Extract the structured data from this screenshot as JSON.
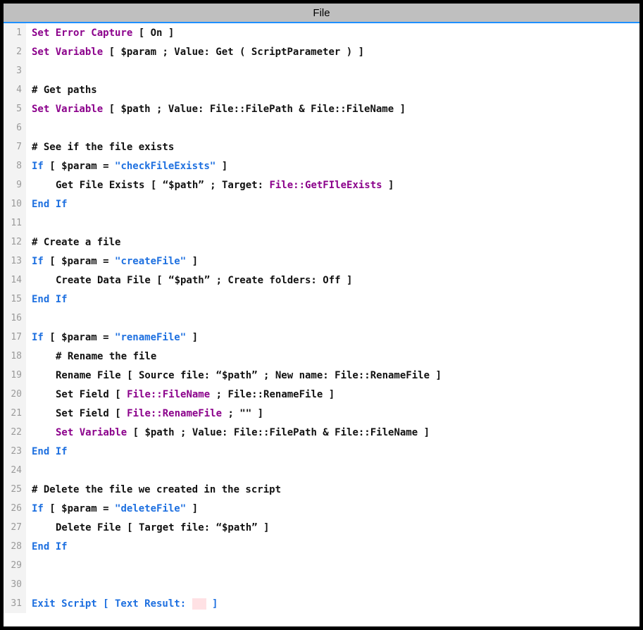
{
  "title": "File",
  "colors": {
    "titlebar": "#bfbfbf",
    "accent": "#1e90ff",
    "keywordSet": "#8b008b",
    "keywordCtrl": "#1e70e0",
    "field": "#8b008b",
    "string": "#1e70e0",
    "gutterBg": "#f3f3f3",
    "gutterFg": "#9a9a9a",
    "emptyBox": "#ffe1e4"
  },
  "lines": [
    {
      "n": 1,
      "indent": 0,
      "tokens": [
        {
          "t": "Set Error Capture",
          "c": "kw-set"
        },
        {
          "t": " [ On ]",
          "c": "normal"
        }
      ]
    },
    {
      "n": 2,
      "indent": 0,
      "tokens": [
        {
          "t": "Set Variable",
          "c": "kw-set"
        },
        {
          "t": " [ $param ; Value: Get ( ScriptParameter ) ]",
          "c": "normal"
        }
      ]
    },
    {
      "n": 3,
      "indent": 0,
      "tokens": []
    },
    {
      "n": 4,
      "indent": 0,
      "tokens": [
        {
          "t": "# Get paths",
          "c": "comment"
        }
      ]
    },
    {
      "n": 5,
      "indent": 0,
      "tokens": [
        {
          "t": "Set Variable",
          "c": "kw-set"
        },
        {
          "t": " [ $path ; Value: File::FilePath & File::FileName ]",
          "c": "normal"
        }
      ]
    },
    {
      "n": 6,
      "indent": 0,
      "tokens": []
    },
    {
      "n": 7,
      "indent": 0,
      "tokens": [
        {
          "t": "# See if the file exists",
          "c": "comment"
        }
      ]
    },
    {
      "n": 8,
      "indent": 0,
      "tokens": [
        {
          "t": "If",
          "c": "kw-ctrl"
        },
        {
          "t": " [ $param = ",
          "c": "normal"
        },
        {
          "t": "\"checkFileExists\"",
          "c": "str"
        },
        {
          "t": " ]",
          "c": "normal"
        }
      ]
    },
    {
      "n": 9,
      "indent": 1,
      "tokens": [
        {
          "t": "Get File Exists [ “$path” ; Target: ",
          "c": "normal"
        },
        {
          "t": "File::GetFIleExists",
          "c": "field"
        },
        {
          "t": " ]",
          "c": "normal"
        }
      ]
    },
    {
      "n": 10,
      "indent": 0,
      "tokens": [
        {
          "t": "End If",
          "c": "kw-ctrl"
        }
      ]
    },
    {
      "n": 11,
      "indent": 0,
      "tokens": []
    },
    {
      "n": 12,
      "indent": 0,
      "tokens": [
        {
          "t": "# Create a file",
          "c": "comment"
        }
      ]
    },
    {
      "n": 13,
      "indent": 0,
      "tokens": [
        {
          "t": "If",
          "c": "kw-ctrl"
        },
        {
          "t": " [ $param = ",
          "c": "normal"
        },
        {
          "t": "\"createFile\"",
          "c": "str"
        },
        {
          "t": " ]",
          "c": "normal"
        }
      ]
    },
    {
      "n": 14,
      "indent": 1,
      "tokens": [
        {
          "t": "Create Data File [ “$path” ; Create folders: Off ]",
          "c": "normal"
        }
      ]
    },
    {
      "n": 15,
      "indent": 0,
      "tokens": [
        {
          "t": "End If",
          "c": "kw-ctrl"
        }
      ]
    },
    {
      "n": 16,
      "indent": 0,
      "tokens": []
    },
    {
      "n": 17,
      "indent": 0,
      "tokens": [
        {
          "t": "If",
          "c": "kw-ctrl"
        },
        {
          "t": " [ $param = ",
          "c": "normal"
        },
        {
          "t": "\"renameFile\"",
          "c": "str"
        },
        {
          "t": " ]",
          "c": "normal"
        }
      ]
    },
    {
      "n": 18,
      "indent": 1,
      "tokens": [
        {
          "t": "# Rename the file",
          "c": "comment"
        }
      ]
    },
    {
      "n": 19,
      "indent": 1,
      "tokens": [
        {
          "t": "Rename File [ Source file: “$path” ; New name: File::RenameFile ]",
          "c": "normal"
        }
      ]
    },
    {
      "n": 20,
      "indent": 1,
      "tokens": [
        {
          "t": "Set Field [ ",
          "c": "normal"
        },
        {
          "t": "File::FileName",
          "c": "field"
        },
        {
          "t": " ; File::RenameFile ]",
          "c": "normal"
        }
      ]
    },
    {
      "n": 21,
      "indent": 1,
      "tokens": [
        {
          "t": "Set Field [ ",
          "c": "normal"
        },
        {
          "t": "File::RenameFile",
          "c": "field"
        },
        {
          "t": " ; \"\" ]",
          "c": "normal"
        }
      ]
    },
    {
      "n": 22,
      "indent": 1,
      "tokens": [
        {
          "t": "Set Variable",
          "c": "kw-set"
        },
        {
          "t": " [ $path ; Value: File::FilePath & File::FileName ]",
          "c": "normal"
        }
      ]
    },
    {
      "n": 23,
      "indent": 0,
      "tokens": [
        {
          "t": "End If",
          "c": "kw-ctrl"
        }
      ]
    },
    {
      "n": 24,
      "indent": 0,
      "tokens": []
    },
    {
      "n": 25,
      "indent": 0,
      "tokens": [
        {
          "t": "# Delete the file we created in the script",
          "c": "comment"
        }
      ]
    },
    {
      "n": 26,
      "indent": 0,
      "tokens": [
        {
          "t": "If",
          "c": "kw-ctrl"
        },
        {
          "t": " [ $param = ",
          "c": "normal"
        },
        {
          "t": "\"deleteFile\"",
          "c": "str"
        },
        {
          "t": " ]",
          "c": "normal"
        }
      ]
    },
    {
      "n": 27,
      "indent": 1,
      "tokens": [
        {
          "t": "Delete File [ Target file: “$path” ]",
          "c": "normal"
        }
      ]
    },
    {
      "n": 28,
      "indent": 0,
      "tokens": [
        {
          "t": "End If",
          "c": "kw-ctrl"
        }
      ]
    },
    {
      "n": 29,
      "indent": 0,
      "tokens": []
    },
    {
      "n": 30,
      "indent": 0,
      "tokens": []
    },
    {
      "n": 31,
      "indent": 0,
      "tokens": [
        {
          "t": "Exit Script",
          "c": "kw-ctrl"
        },
        {
          "t": " [ Text Result: ",
          "c": "kw-ctrl"
        },
        {
          "t": "",
          "c": "box"
        },
        {
          "t": " ]",
          "c": "kw-ctrl"
        }
      ]
    }
  ]
}
